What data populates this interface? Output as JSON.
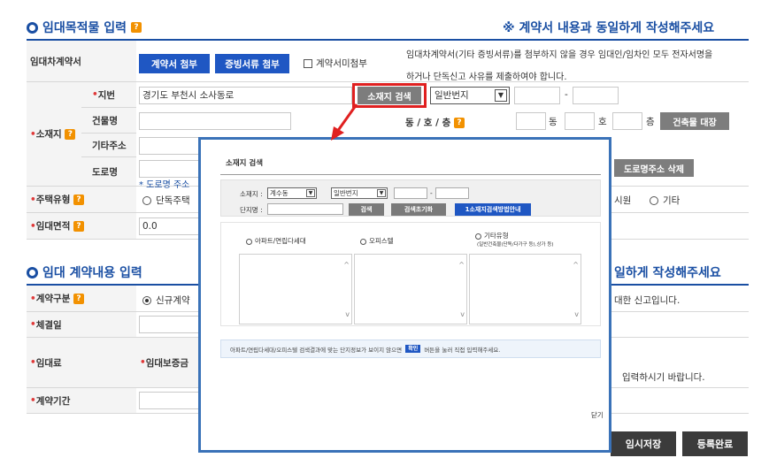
{
  "section1": {
    "title": "임대목적물 입력",
    "notice": "※ 계약서 내용과 동일하게 작성해주세요"
  },
  "contract_doc": {
    "label": "임대차계약서",
    "attach_btn": "계약서 첨부",
    "evidence_btn": "증빙서류 첨부",
    "no_attach_label": "계약서미첨부",
    "help": [
      "임대차계약서(기타 증빙서류)를 첨부하지 않을 경우 임대인/임차인 모두 전자서명을",
      "하거나 단독신고 사유를 제출하여야 합니다."
    ]
  },
  "location": {
    "label": "소재지",
    "jibun_label": "지번",
    "address_value": "경기도 부천시 소사동로",
    "search_btn": "소재지 검색",
    "lot_type": "일반번지",
    "dash": "-",
    "building_label": "건물명",
    "dong_ho_label": "동 / 호 / 층",
    "dong": "동",
    "ho": "호",
    "floor": "층",
    "ledger_btn": "건축물 대장",
    "etc_addr_label": "기타주소",
    "road_label": "도로명",
    "road_note": "* 도로명 주소",
    "road_delete_btn": "도로명주소 삭제"
  },
  "housing_type": {
    "label": "주택유형",
    "option1": "단독주택",
    "option_right1": "시원",
    "option_right2": "기타"
  },
  "area": {
    "label": "임대면적",
    "value": "0.0"
  },
  "section2": {
    "title": "임대 계약내용 입력",
    "notice_tail": "일하게 작성해주세요"
  },
  "contract": {
    "type_label": "계약구분",
    "type_option": "신규계약",
    "type_note": "대한 신고입니다.",
    "date_label": "체결일",
    "rent_label": "임대료",
    "deposit_label": "임대보증금",
    "rent_note": "입력하시기 바랍니다.",
    "period_label": "계약기간"
  },
  "buttons": {
    "temp_save": "임시저장",
    "submit": "등록완료"
  },
  "modal": {
    "title": "소재지 검색",
    "location_label": "소재지 :",
    "location_value": "계수동",
    "lot_type": "일반번지",
    "dash": "-",
    "complex_label": "단지명 :",
    "search_btn": "검색",
    "reset_btn": "검색초기화",
    "guide_btn": "1소재지검색방법안내",
    "col1": "아파트/연립다세대",
    "col2": "오피스텔",
    "col3": "기타유형",
    "col3_sub": "(일반건축물(단독/다가구 등),상가 등)",
    "info_pre": "아파트/연립다세대/오피스텔 검색결과에 맞는 단지정보가 보이지 않으면",
    "info_btn": "확인",
    "info_post": "버튼을 눌러 직접 입력해주세요.",
    "close": "닫기"
  },
  "colors": {
    "primary": "#1a4fa3",
    "button_blue": "#1f57c3",
    "highlight_red": "#e02020",
    "required": "#e03a3a"
  }
}
